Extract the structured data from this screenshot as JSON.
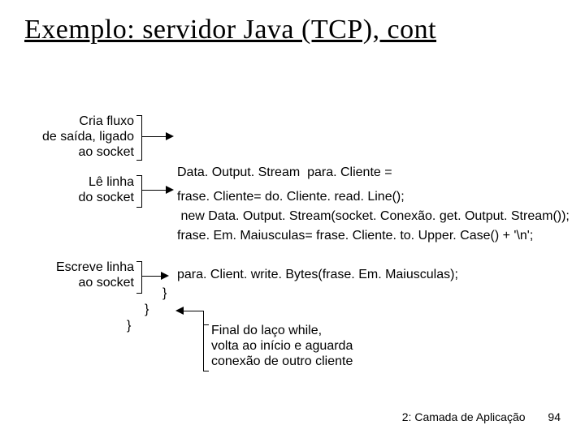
{
  "title": "Exemplo: servidor Java (TCP), cont",
  "ann1_l1": "Cria fluxo",
  "ann1_l2": "de saída, ligado",
  "ann1_l3": "ao socket",
  "ann2_l1": "Lê linha",
  "ann2_l2": "do socket",
  "ann3_l1": "Escreve linha",
  "ann3_l2": "ao socket",
  "code1_l1": "Data. Output. Stream  para. Cliente =",
  "code1_l2": " new Data. Output. Stream(socket. Conexão. get. Output. Stream());",
  "code2": "frase. Cliente= do. Cliente. read. Line();",
  "code3": "frase. Em. Maiusculas= frase. Cliente. to. Upper. Case() + '\\n';",
  "code4": "para. Client. write. Bytes(frase. Em. Maiusculas);",
  "brace1": "}",
  "brace2": "}",
  "brace3": "}",
  "note_l1": "Final do laço while,",
  "note_l2": "volta ao início e aguarda",
  "note_l3": "conexão de outro cliente",
  "footer_text": "2: Camada de Aplicação",
  "footer_page": "94"
}
